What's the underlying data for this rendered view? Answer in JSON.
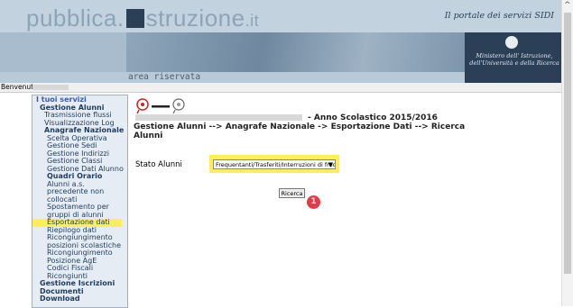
{
  "header": {
    "logo_left": "pubblica.",
    "logo_right": "struzione",
    "logo_tld": ".it",
    "motto": "Il portale dei servizi SIDI",
    "ministry": "Ministero dell' Istruzione, dell'Università e della Ricerca",
    "area": "area riservata"
  },
  "welcome": "Benvenuto,",
  "sidebar": {
    "heading": "I tuoi servizi",
    "items": [
      "Gestione Alunni",
      "Trasmissione flussi",
      "Visualizzazione Log",
      "Anagrafe Nazionale",
      "Scelta Operativa",
      "Gestione Sedi",
      "Gestione Indirizzi",
      "Gestione Classi",
      "Gestione Dati Alunno",
      "Quadri Orario",
      "Alunni a.s. precedente non collocati",
      "Spostamento per gruppi di alunni",
      "Esportazione dati",
      "Riepilogo dati",
      "Ricongiungimento posizioni scolastiche",
      "Ricongiungimento Posizione AgE",
      "Codici Fiscali Ricongiunti",
      "Gestione Iscrizioni",
      "Documenti",
      "Download"
    ]
  },
  "main": {
    "year": "- Anno Scolastico 2015/2016",
    "path": "Gestione Alunni --> Anagrafe Nazionale -> Esportazione Dati --> Ricerca Alunni",
    "stato_label": "Stato Alunni",
    "stato_value": "Frequentanti/Trasferiti/Interruzioni di frequenza",
    "search_label": "Ricerca",
    "badge": "1"
  },
  "colors": {
    "highlight": "#ffee55",
    "navy": "#2b3f57",
    "badge": "#e63946"
  }
}
